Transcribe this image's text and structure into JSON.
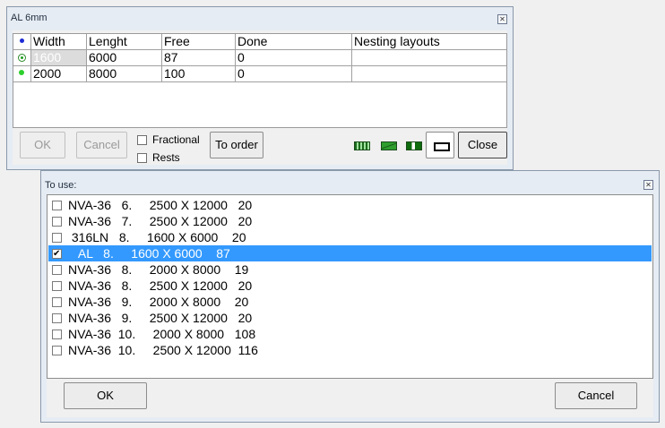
{
  "top_window": {
    "title": "AL  6mm",
    "columns": [
      "Width",
      "Lenght",
      "Free",
      "Done",
      "Nesting layouts"
    ],
    "rows": [
      {
        "width": "1600",
        "length": "6000",
        "free": "87",
        "done": "0",
        "layouts": ""
      },
      {
        "width": "2000",
        "length": "8000",
        "free": "100",
        "done": "0",
        "layouts": ""
      }
    ],
    "buttons": {
      "ok": "OK",
      "cancel": "Cancel",
      "to_order": "To order",
      "close": "Close"
    },
    "checkboxes": {
      "fractional": "Fractional",
      "rests": "Rests"
    },
    "icons": [
      "grid-pattern-icon",
      "diagonal-cut-icon",
      "strip-cut-icon",
      "rectangle-icon"
    ]
  },
  "bottom_window": {
    "title": "To use:",
    "items": [
      {
        "text": "NVA-36   6.     2500 X 12000   20",
        "checked": false,
        "selected": false
      },
      {
        "text": "NVA-36   7.     2500 X 12000   20",
        "checked": false,
        "selected": false
      },
      {
        "text": " 316LN   8.     1600 X 6000    20",
        "checked": false,
        "selected": false
      },
      {
        "text": "   AL   8.     1600 X 6000    87",
        "checked": true,
        "selected": true
      },
      {
        "text": "NVA-36   8.     2000 X 8000    19",
        "checked": false,
        "selected": false
      },
      {
        "text": "NVA-36   8.     2500 X 12000   20",
        "checked": false,
        "selected": false
      },
      {
        "text": "NVA-36   9.     2000 X 8000    20",
        "checked": false,
        "selected": false
      },
      {
        "text": "NVA-36   9.     2500 X 12000   20",
        "checked": false,
        "selected": false
      },
      {
        "text": "NVA-36  10.     2000 X 8000   108",
        "checked": false,
        "selected": false
      },
      {
        "text": "NVA-36  10.     2500 X 12000  116",
        "checked": false,
        "selected": false
      }
    ],
    "buttons": {
      "ok": "OK",
      "cancel": "Cancel"
    }
  },
  "colors": {
    "selection": "#3399ff",
    "title_bg": "#e6ecf3",
    "dot_blue": "#1d2bd6",
    "dot_green": "#2ccf2c"
  }
}
